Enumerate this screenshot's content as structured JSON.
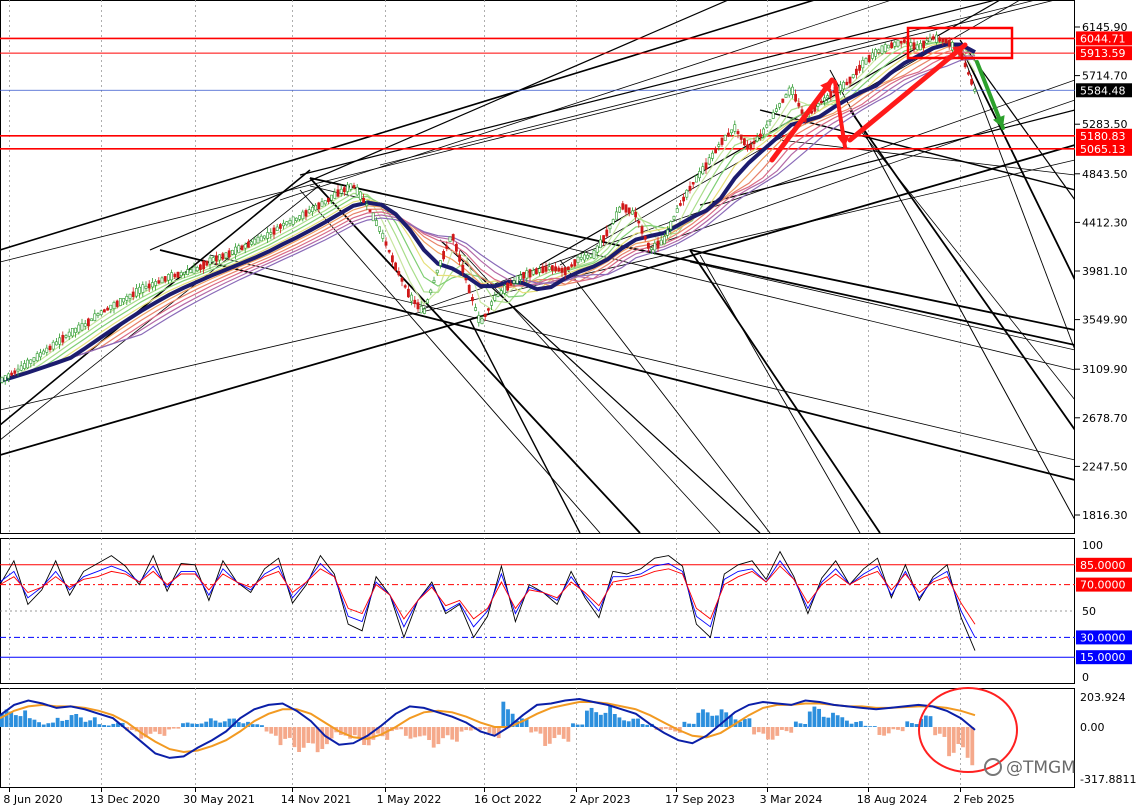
{
  "chart_data": [
    {
      "type": "line",
      "panel": "price",
      "y_ticks": [
        "6145.90",
        "5714.70",
        "5283.50",
        "4843.50",
        "4412.30",
        "3981.10",
        "3549.90",
        "3109.90",
        "2678.70",
        "2247.50",
        "1816.30"
      ],
      "y_tick_values": [
        6145.9,
        5714.7,
        5283.5,
        4843.5,
        4412.3,
        3981.1,
        3549.9,
        3109.9,
        2678.7,
        2247.5,
        1816.3
      ],
      "ylim": [
        1720,
        6200
      ],
      "price_labels": [
        {
          "text": "6044.71",
          "value": 6044.71,
          "bg": "#ff0000"
        },
        {
          "text": "5913.59",
          "value": 5913.59,
          "bg": "#ff0000"
        },
        {
          "text": "5584.48",
          "value": 5584.48,
          "bg": "#000000"
        },
        {
          "text": "5180.83",
          "value": 5180.83,
          "bg": "#ff0000"
        },
        {
          "text": "5065.13",
          "value": 5065.13,
          "bg": "#ff0000"
        }
      ],
      "h_levels": [
        {
          "value": 6044.71,
          "color": "#ff0000",
          "width": 1.6
        },
        {
          "value": 5913.59,
          "color": "#ff0000",
          "width": 1.0
        },
        {
          "value": 5584.48,
          "color": "#3355cc",
          "width": 0.8
        },
        {
          "value": 5180.83,
          "color": "#ff0000",
          "width": 1.6
        },
        {
          "value": 5065.13,
          "color": "#ff0000",
          "width": 1.6
        }
      ],
      "series": [
        {
          "values": [
            3005,
            3080,
            3160,
            3250,
            3340,
            3430,
            3500,
            3600,
            3670,
            3740,
            3820,
            3870,
            3930,
            3960,
            4000,
            4080,
            4120,
            4180,
            4240,
            4300,
            4390,
            4440,
            4520,
            4590,
            4680,
            4740,
            4560,
            4320,
            4020,
            3760,
            3610,
            4000,
            4310,
            3900,
            3510,
            3740,
            3850,
            3940,
            3980,
            4010,
            3980,
            4090,
            4120,
            4330,
            4560,
            4480,
            4170,
            4250,
            4540,
            4750,
            4920,
            5120,
            5250,
            5070,
            5210,
            5420,
            5600,
            5330,
            5470,
            5570,
            5650,
            5810,
            5920,
            5980,
            6020,
            5960,
            6050,
            6020,
            5910,
            5580
          ],
          "color": "#000000"
        }
      ],
      "x_ticks": [
        "8 Jun 2020",
        "13 Dec 2020",
        "30 May 2021",
        "14 Nov 2021",
        "1 May 2022",
        "16 Oct 2022",
        "2 Apr 2023",
        "17 Sep 2023",
        "3 Mar 2024",
        "18 Aug 2024",
        "2 Feb 2025"
      ],
      "grid": true
    },
    {
      "type": "line",
      "panel": "oscillator",
      "ylim": [
        0,
        100
      ],
      "y_ticks": [
        "100",
        "50",
        "0"
      ],
      "levels": [
        {
          "text": "85.0000",
          "value": 85,
          "bg": "#ff0000"
        },
        {
          "text": "70.0000",
          "value": 70,
          "bg": "#ff0000"
        },
        {
          "text": "30.0000",
          "value": 30,
          "bg": "#0000ff"
        },
        {
          "text": "15.0000",
          "value": 15,
          "bg": "#0000ff"
        }
      ],
      "series": [
        {
          "color": "#000000",
          "values": [
            70,
            88,
            55,
            66,
            88,
            62,
            80,
            86,
            92,
            84,
            70,
            92,
            65,
            86,
            85,
            58,
            88,
            72,
            64,
            82,
            90,
            56,
            70,
            92,
            78,
            40,
            35,
            76,
            62,
            30,
            58,
            72,
            48,
            55,
            30,
            46,
            84,
            42,
            70,
            64,
            55,
            80,
            60,
            45,
            80,
            78,
            82,
            90,
            92,
            84,
            40,
            30,
            78,
            85,
            88,
            74,
            95,
            76,
            48,
            75,
            88,
            70,
            82,
            90,
            60,
            85,
            58,
            76,
            85,
            45,
            20
          ]
        },
        {
          "color": "#0000ff",
          "values": [
            72,
            80,
            60,
            68,
            80,
            66,
            76,
            80,
            84,
            80,
            72,
            84,
            68,
            80,
            80,
            62,
            82,
            72,
            66,
            78,
            84,
            60,
            72,
            86,
            76,
            46,
            42,
            72,
            62,
            38,
            58,
            70,
            50,
            56,
            38,
            50,
            78,
            48,
            68,
            64,
            58,
            76,
            62,
            50,
            76,
            76,
            78,
            84,
            86,
            80,
            46,
            38,
            74,
            80,
            82,
            72,
            88,
            74,
            52,
            72,
            82,
            70,
            78,
            84,
            62,
            80,
            60,
            74,
            80,
            50,
            30
          ]
        },
        {
          "color": "#ff0000",
          "values": [
            70,
            76,
            64,
            68,
            76,
            68,
            74,
            76,
            80,
            78,
            72,
            80,
            70,
            78,
            78,
            66,
            78,
            72,
            68,
            76,
            80,
            64,
            72,
            82,
            76,
            52,
            48,
            70,
            62,
            44,
            58,
            68,
            54,
            58,
            44,
            52,
            72,
            52,
            66,
            64,
            60,
            72,
            64,
            54,
            72,
            74,
            76,
            80,
            82,
            78,
            52,
            44,
            70,
            76,
            80,
            72,
            84,
            74,
            56,
            70,
            78,
            70,
            76,
            80,
            66,
            78,
            64,
            72,
            76,
            56,
            40
          ]
        }
      ]
    },
    {
      "type": "bar",
      "panel": "macd",
      "y_ticks": [
        "203.924",
        "0.00",
        "-317.8811"
      ],
      "ylim": [
        -317.8811,
        250
      ],
      "histogram": [
        120,
        140,
        60,
        30,
        80,
        90,
        70,
        20,
        30,
        -40,
        -80,
        -60,
        -20,
        30,
        40,
        60,
        60,
        50,
        20,
        -60,
        -140,
        -170,
        -200,
        -150,
        -60,
        -110,
        -130,
        -90,
        -30,
        -80,
        -110,
        -140,
        -100,
        -40,
        -20,
        -80,
        180,
        60,
        -60,
        -130,
        -100,
        30,
        130,
        160,
        90,
        60,
        30,
        -20,
        -40,
        40,
        120,
        140,
        100,
        60,
        -70,
        -90,
        -40,
        40,
        140,
        120,
        80,
        40,
        10,
        -60,
        -30,
        40,
        80,
        -90,
        -200,
        -260
      ],
      "macd_line": [
        80,
        150,
        180,
        160,
        130,
        140,
        120,
        90,
        60,
        -20,
        -100,
        -180,
        -210,
        -200,
        -140,
        -90,
        -30,
        60,
        120,
        150,
        160,
        110,
        40,
        -60,
        -120,
        -110,
        -60,
        10,
        90,
        140,
        130,
        100,
        70,
        30,
        -30,
        -60,
        0,
        80,
        150,
        160,
        180,
        190,
        170,
        150,
        120,
        90,
        20,
        -40,
        -90,
        -110,
        -60,
        20,
        100,
        150,
        170,
        160,
        150,
        180,
        170,
        150,
        140,
        130,
        120,
        130,
        140,
        150,
        140,
        110,
        60,
        -20
      ],
      "signal_line": [
        60,
        110,
        140,
        150,
        140,
        140,
        130,
        110,
        80,
        30,
        -40,
        -100,
        -150,
        -170,
        -160,
        -130,
        -90,
        -30,
        40,
        90,
        120,
        120,
        90,
        30,
        -30,
        -70,
        -80,
        -50,
        0,
        60,
        100,
        110,
        100,
        70,
        30,
        0,
        0,
        40,
        90,
        130,
        150,
        170,
        170,
        160,
        140,
        120,
        80,
        30,
        -20,
        -60,
        -70,
        -40,
        20,
        80,
        130,
        150,
        150,
        160,
        160,
        150,
        140,
        140,
        130,
        130,
        135,
        140,
        140,
        130,
        110,
        80
      ],
      "colors": {
        "hist_pos": "#2c8fdd",
        "hist_neg": "#f5a98b",
        "macd": "#0b1fa8",
        "signal": "#f29a22"
      }
    }
  ],
  "watermark": {
    "text": "@TMGM"
  }
}
